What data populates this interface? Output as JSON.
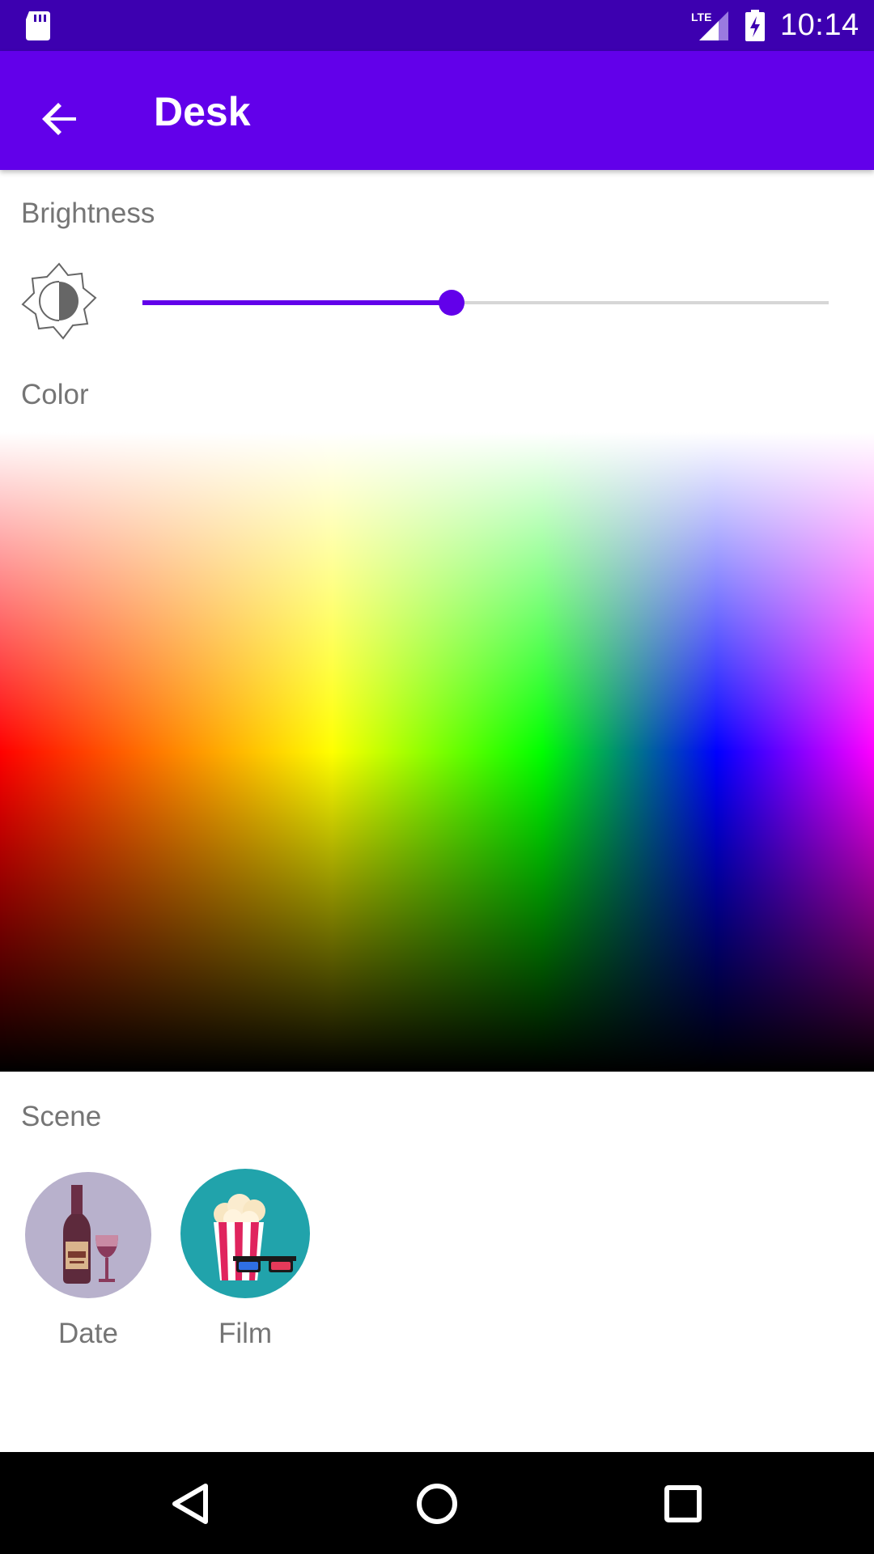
{
  "status_bar": {
    "time": "10:14",
    "network_label": "LTE",
    "icons": [
      "sd-card-icon",
      "lte-signal-icon",
      "battery-charging-icon"
    ]
  },
  "app_bar": {
    "title": "Desk",
    "back_icon": "arrow-back-icon"
  },
  "brightness": {
    "label": "Brightness",
    "icon": "brightness-icon",
    "value_fraction": 0.45
  },
  "color": {
    "label": "Color"
  },
  "scene": {
    "label": "Scene",
    "items": [
      {
        "label": "Date",
        "icon": "wine-bottle-glass-icon",
        "bg": "#b8b1cc"
      },
      {
        "label": "Film",
        "icon": "popcorn-3d-glasses-icon",
        "bg": "#21a3ab"
      }
    ]
  },
  "nav_bar": {
    "items": [
      "back-triangle-icon",
      "home-circle-icon",
      "recents-square-icon"
    ]
  },
  "colors": {
    "status_bar": "#3d00b0",
    "app_bar": "#6200ea",
    "accent": "#6200ea",
    "label_text": "#757575"
  }
}
